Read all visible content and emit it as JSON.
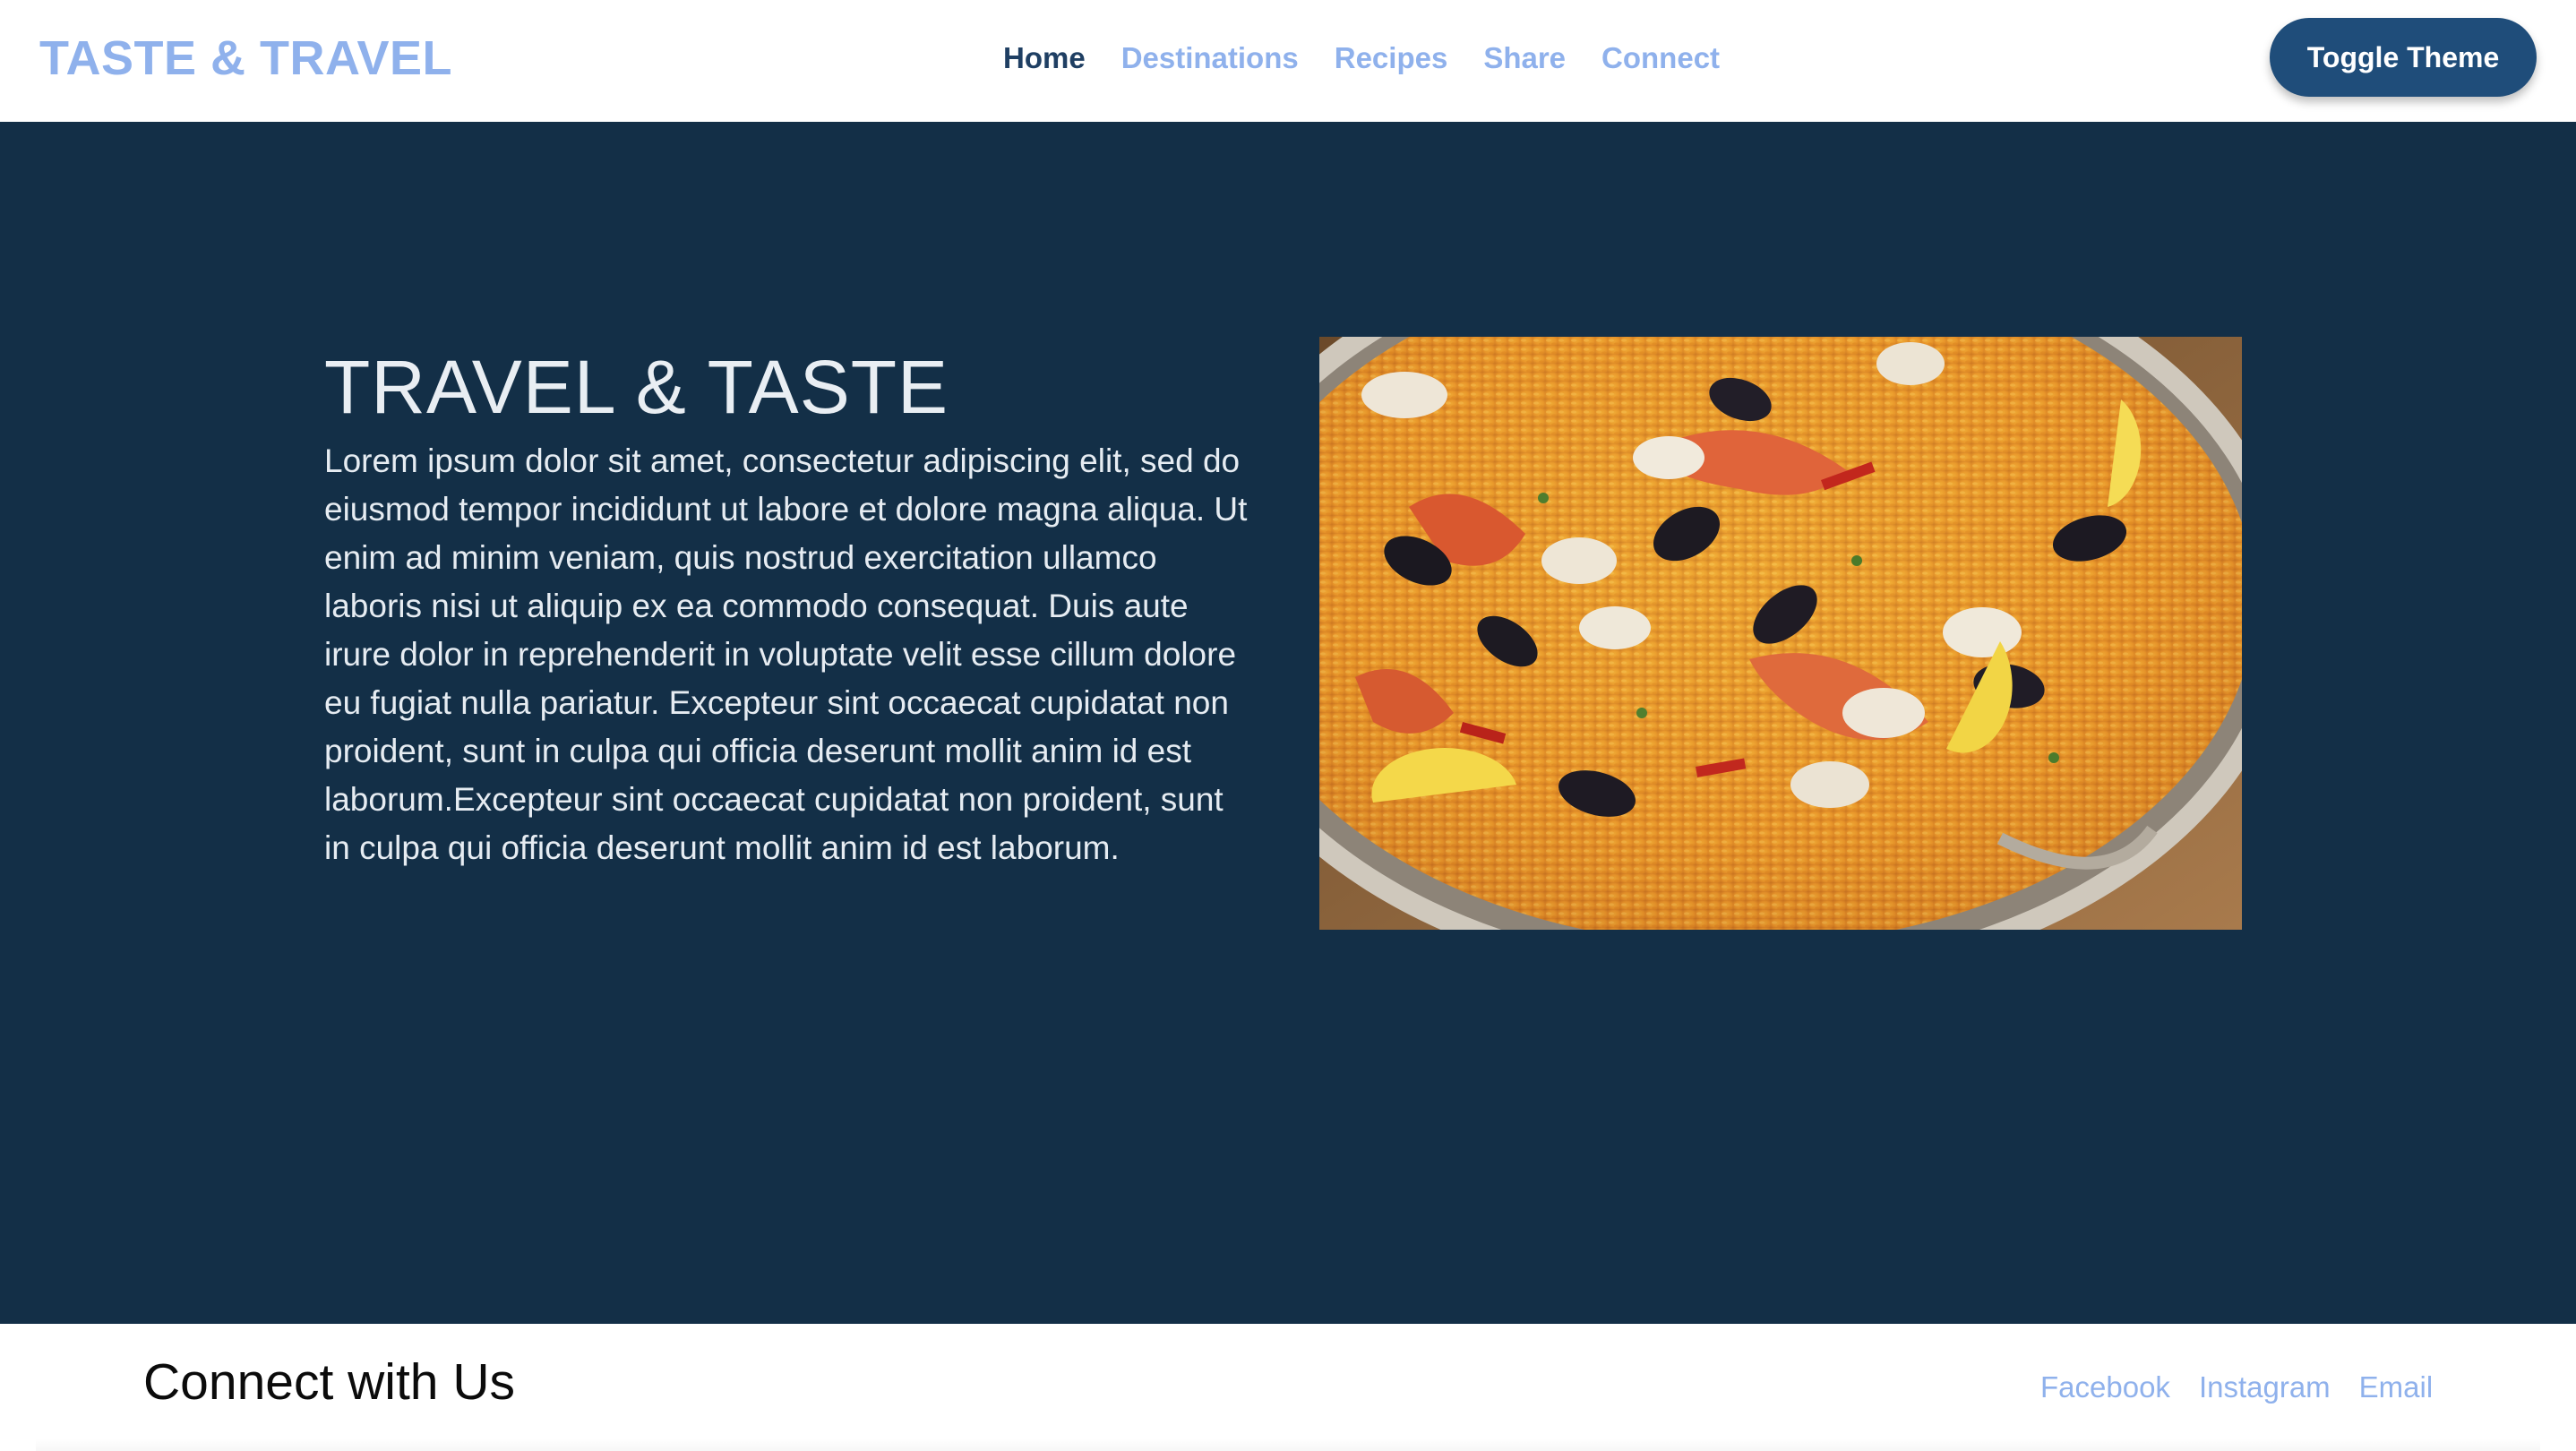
{
  "header": {
    "brand": "TASTE & TRAVEL",
    "nav": [
      {
        "label": "Home",
        "active": true
      },
      {
        "label": "Destinations",
        "active": false
      },
      {
        "label": "Recipes",
        "active": false
      },
      {
        "label": "Share",
        "active": false
      },
      {
        "label": "Connect",
        "active": false
      }
    ],
    "toggle_label": "Toggle Theme"
  },
  "hero": {
    "title": "TRAVEL & TASTE",
    "text": "Lorem ipsum dolor sit amet, consectetur adipiscing elit, sed do eiusmod tempor incididunt ut labore et dolore magna aliqua. Ut enim ad minim veniam, quis nostrud exercitation ullamco laboris nisi ut aliquip ex ea commodo consequat. Duis aute irure dolor in reprehenderit in voluptate velit esse cillum dolore eu fugiat nulla pariatur. Excepteur sint occaecat cupidatat non proident, sunt in culpa qui officia deserunt mollit anim id est laborum.Excepteur sint occaecat cupidatat non proident, sunt in culpa qui officia deserunt mollit anim id est laborum.",
    "image_subject": "seafood-paella-image"
  },
  "footer": {
    "title": "Connect with Us",
    "links": [
      "Facebook",
      "Instagram",
      "Email"
    ]
  },
  "colors": {
    "brand": "#8fb1ec",
    "nav_active": "#1f3f63",
    "button": "#1f4d7a",
    "hero_bg": "#132f47"
  }
}
